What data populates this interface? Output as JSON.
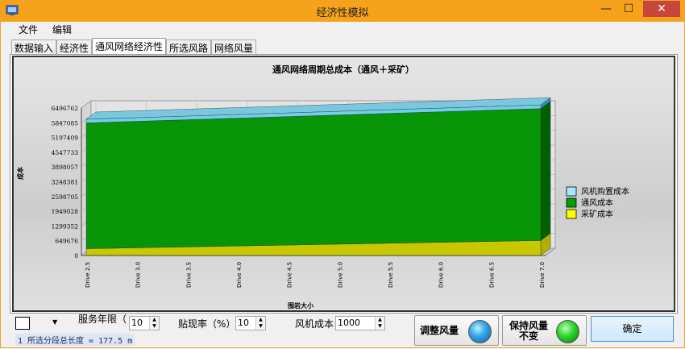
{
  "window": {
    "title": "经济性模拟"
  },
  "titlebar_buttons": {
    "minimize": "—",
    "maximize": "☐",
    "close": "✕"
  },
  "menu": [
    "文件",
    "编辑"
  ],
  "tabs": [
    "数据输入",
    "经济性",
    "通风网络经济性",
    "所选风路",
    "网络风量"
  ],
  "active_tab": 2,
  "chart_data": {
    "type": "bar",
    "title": "通风网络周期总成本（通风＋采矿）",
    "xlabel": "围岩大小",
    "ylabel": "成本",
    "stacked": true,
    "three_d": true,
    "categories": [
      "Drive 2.5",
      "Drive 3.0",
      "Drive 3.5",
      "Drive 4.0",
      "Drive 4.5",
      "Drive 5.0",
      "Drive 5.5",
      "Drive 6.0",
      "Drive 6.5",
      "Drive 7.0"
    ],
    "y_ticks": [
      "0",
      "649676",
      "1299352",
      "1949028",
      "2598705",
      "3248381",
      "3898057",
      "4547733",
      "5197409",
      "5847085",
      "6496762"
    ],
    "ylim": [
      0,
      6496762
    ],
    "series": [
      {
        "name": "采矿成本",
        "color": "#ffff00",
        "values": [
          300000,
          340000,
          380000,
          420000,
          460000,
          500000,
          540000,
          580000,
          620000,
          660000
        ]
      },
      {
        "name": "通风成本",
        "color": "#00a000",
        "values": [
          5540000,
          5570000,
          5600000,
          5630000,
          5660000,
          5690000,
          5720000,
          5750000,
          5780000,
          5810000
        ]
      },
      {
        "name": "风机购置成本",
        "color": "#a8e8f8",
        "values": [
          160000,
          160000,
          160000,
          160000,
          160000,
          160000,
          160000,
          160000,
          160000,
          160000
        ]
      }
    ],
    "legend_position": "right",
    "grid": true
  },
  "bottom": {
    "service_years_label": "服务年限（",
    "service_years_value": "10",
    "discount_rate_label": "贴现率（%）",
    "discount_rate_value": "10",
    "fan_cost_label": "风机成本",
    "fan_cost_value": "1000",
    "status_text": "1 所选分段总长度 = 177.5 m",
    "adjust_airflow_button": "调整风量",
    "keep_airflow_button_line1": "保持风量",
    "keep_airflow_button_line2": "不变",
    "ok_button": "确定",
    "combo_arrow": "▼",
    "spin_arrow_up": "▲",
    "spin_arrow_down": "▼"
  }
}
